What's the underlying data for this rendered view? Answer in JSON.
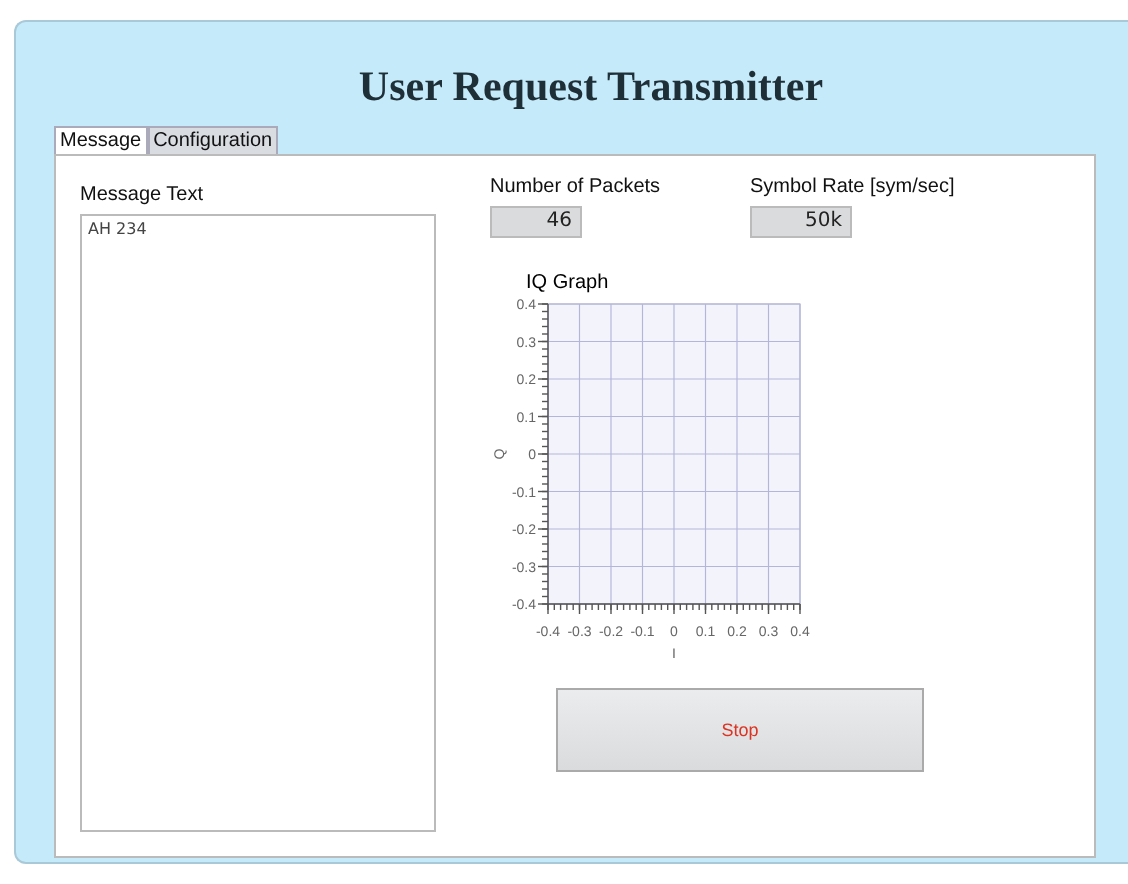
{
  "window": {
    "title": "User Request Transmitter"
  },
  "tabs": [
    {
      "label": "Message",
      "selected": true
    },
    {
      "label": "Configuration",
      "selected": false
    }
  ],
  "message": {
    "label": "Message Text",
    "value": "AH 234"
  },
  "fields": [
    {
      "label": "Number of Packets",
      "value": "46"
    },
    {
      "label": "Symbol Rate [sym/sec]",
      "value": "50k"
    }
  ],
  "graph": {
    "title": "IQ Graph",
    "chart_data": {
      "type": "scatter",
      "grid": true,
      "xlabel": "I",
      "ylabel": "Q",
      "xlim": [
        -0.4,
        0.4
      ],
      "ylim": [
        -0.4,
        0.4
      ],
      "xticks": [
        -0.4,
        -0.3,
        -0.2,
        -0.1,
        0,
        0.1,
        0.2,
        0.3,
        0.4
      ],
      "yticks": [
        -0.4,
        -0.3,
        -0.2,
        -0.1,
        0,
        0.1,
        0.2,
        0.3,
        0.4
      ]
    }
  },
  "button": {
    "label": "Stop"
  }
}
